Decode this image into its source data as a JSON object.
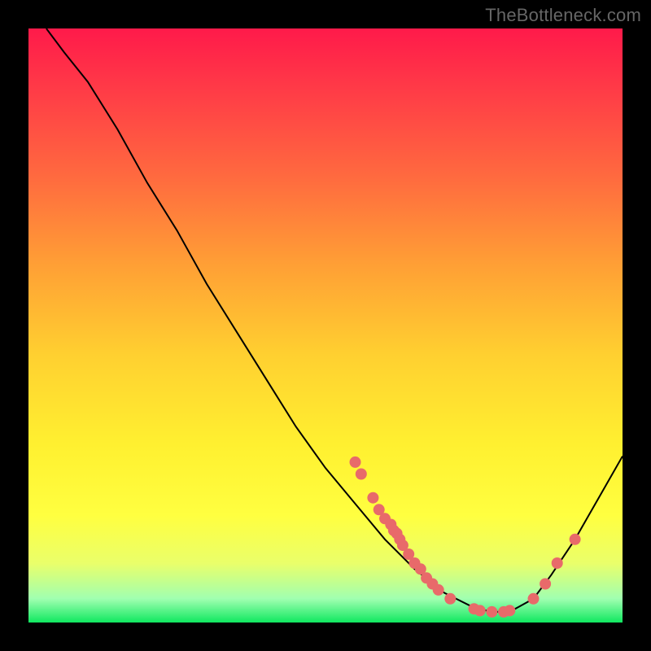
{
  "watermark": "TheBottleneck.com",
  "chart_data": {
    "type": "line",
    "title": "",
    "xlabel": "",
    "ylabel": "",
    "xlim": [
      0,
      100
    ],
    "ylim": [
      0,
      100
    ],
    "curve": [
      {
        "x": 3,
        "y": 100
      },
      {
        "x": 6,
        "y": 96
      },
      {
        "x": 10,
        "y": 91
      },
      {
        "x": 15,
        "y": 83
      },
      {
        "x": 20,
        "y": 74
      },
      {
        "x": 25,
        "y": 66
      },
      {
        "x": 30,
        "y": 57
      },
      {
        "x": 35,
        "y": 49
      },
      {
        "x": 40,
        "y": 41
      },
      {
        "x": 45,
        "y": 33
      },
      {
        "x": 50,
        "y": 26
      },
      {
        "x": 55,
        "y": 20
      },
      {
        "x": 60,
        "y": 14
      },
      {
        "x": 65,
        "y": 9
      },
      {
        "x": 70,
        "y": 5
      },
      {
        "x": 75,
        "y": 2.5
      },
      {
        "x": 78,
        "y": 1.8
      },
      {
        "x": 81,
        "y": 1.8
      },
      {
        "x": 85,
        "y": 4
      },
      {
        "x": 88,
        "y": 8
      },
      {
        "x": 92,
        "y": 14
      },
      {
        "x": 96,
        "y": 21
      },
      {
        "x": 100,
        "y": 28
      }
    ],
    "scatter": [
      {
        "x": 55,
        "y": 27
      },
      {
        "x": 56,
        "y": 25
      },
      {
        "x": 58,
        "y": 21
      },
      {
        "x": 59,
        "y": 19
      },
      {
        "x": 60,
        "y": 17.5
      },
      {
        "x": 61,
        "y": 16.5
      },
      {
        "x": 61.5,
        "y": 15.5
      },
      {
        "x": 62,
        "y": 15
      },
      {
        "x": 62.5,
        "y": 14
      },
      {
        "x": 63,
        "y": 13
      },
      {
        "x": 64,
        "y": 11.5
      },
      {
        "x": 65,
        "y": 10
      },
      {
        "x": 66,
        "y": 9
      },
      {
        "x": 67,
        "y": 7.5
      },
      {
        "x": 68,
        "y": 6.5
      },
      {
        "x": 69,
        "y": 5.5
      },
      {
        "x": 71,
        "y": 4
      },
      {
        "x": 75,
        "y": 2.3
      },
      {
        "x": 76,
        "y": 2
      },
      {
        "x": 78,
        "y": 1.8
      },
      {
        "x": 80,
        "y": 1.8
      },
      {
        "x": 81,
        "y": 2
      },
      {
        "x": 85,
        "y": 4
      },
      {
        "x": 87,
        "y": 6.5
      },
      {
        "x": 89,
        "y": 10
      },
      {
        "x": 92,
        "y": 14
      }
    ],
    "gradient_stops": [
      {
        "pos": 0,
        "color": "#ff1a4a"
      },
      {
        "pos": 10,
        "color": "#ff3a47"
      },
      {
        "pos": 25,
        "color": "#ff6a3f"
      },
      {
        "pos": 40,
        "color": "#ffa035"
      },
      {
        "pos": 55,
        "color": "#ffd030"
      },
      {
        "pos": 70,
        "color": "#fff030"
      },
      {
        "pos": 82,
        "color": "#ffff40"
      },
      {
        "pos": 90,
        "color": "#eaff6a"
      },
      {
        "pos": 96,
        "color": "#a0ffb0"
      },
      {
        "pos": 100,
        "color": "#10e860"
      }
    ],
    "point_color": "#e86a6a",
    "line_color": "#000000"
  }
}
